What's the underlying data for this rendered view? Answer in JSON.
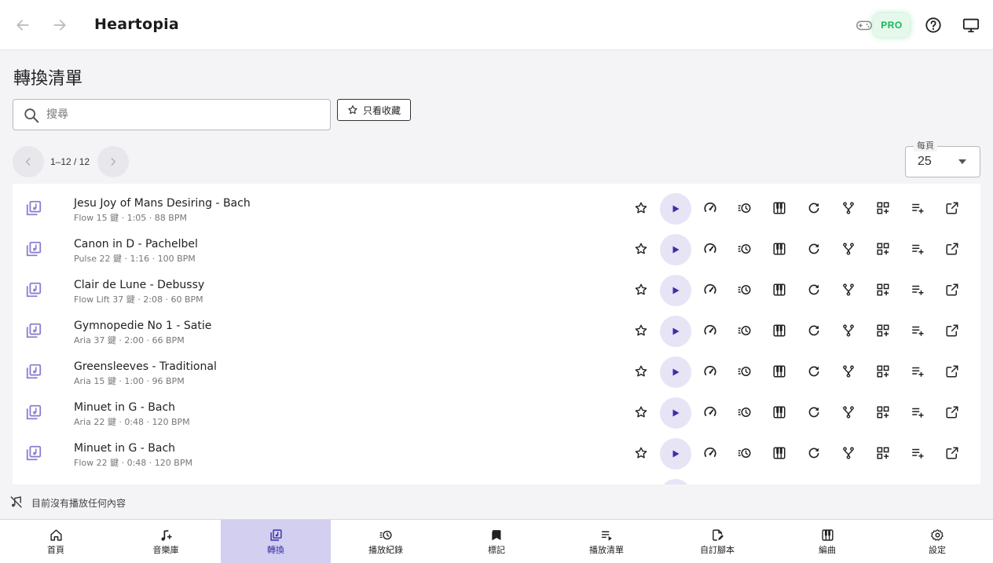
{
  "header": {
    "app_title": "Heartopia",
    "back_icon": "arrow-left-icon",
    "forward_icon": "arrow-right-icon",
    "pro_label": "PRO",
    "icons": [
      "gamepad-icon",
      "help-icon",
      "monitor-icon"
    ]
  },
  "page": {
    "title": "轉換清單",
    "search_placeholder": "搜尋",
    "favorites_only_label": "只看收藏"
  },
  "pagination": {
    "range": "1–12 / 12",
    "per_page_label": "每頁",
    "per_page_value": "25"
  },
  "rows": [
    {
      "title": "Jesu Joy of Mans Desiring - Bach",
      "subtitle": "Flow 15 鍵 · 1:05 · 88 BPM"
    },
    {
      "title": "Canon in D - Pachelbel",
      "subtitle": "Pulse 22 鍵 · 1:16 · 100 BPM"
    },
    {
      "title": "Clair de Lune - Debussy",
      "subtitle": "Flow Lift 37 鍵 · 2:08 · 60 BPM"
    },
    {
      "title": "Gymnopedie No 1 - Satie",
      "subtitle": "Aria 37 鍵 · 2:00 · 66 BPM"
    },
    {
      "title": "Greensleeves - Traditional",
      "subtitle": "Aria 15 鍵 · 1:00 · 96 BPM"
    },
    {
      "title": "Minuet in G - Bach",
      "subtitle": "Aria 22 鍵 · 0:48 · 120 BPM"
    },
    {
      "title": "Minuet in G - Bach",
      "subtitle": "Flow 22 鍵 · 0:48 · 120 BPM"
    }
  ],
  "row_actions": [
    "star-icon",
    "play-icon",
    "speed-icon",
    "history-icon",
    "piano-icon",
    "refresh-icon",
    "fork-icon",
    "grid-add-icon",
    "playlist-add-icon",
    "open-external-icon"
  ],
  "now_playing": {
    "text": "目前沒有播放任何內容",
    "icon": "music-off-icon"
  },
  "bottom_nav": [
    {
      "label": "首頁",
      "icon": "home-icon"
    },
    {
      "label": "音樂庫",
      "icon": "music-add-icon"
    },
    {
      "label": "轉換",
      "icon": "convert-icon",
      "active": true
    },
    {
      "label": "播放紀錄",
      "icon": "history-icon"
    },
    {
      "label": "標記",
      "icon": "bookmark-icon"
    },
    {
      "label": "播放清單",
      "icon": "playlist-play-icon"
    },
    {
      "label": "自訂腳本",
      "icon": "script-edit-icon"
    },
    {
      "label": "編曲",
      "icon": "piano-icon"
    },
    {
      "label": "設定",
      "icon": "settings-icon"
    }
  ],
  "colors": {
    "accent": "#3a2fa8",
    "active_tab_bg": "#d2cff0",
    "play_bg": "#e6e4f5",
    "pro_green": "#1bb55a",
    "row_icon": "#8a7fd0"
  }
}
